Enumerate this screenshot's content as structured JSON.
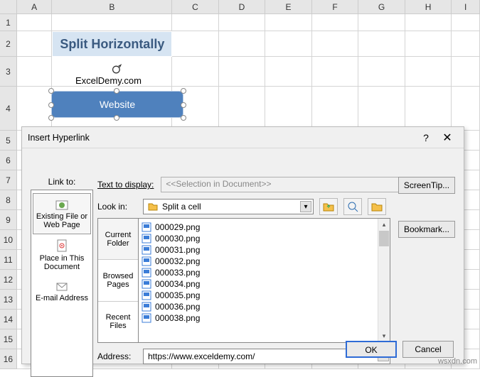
{
  "columns": [
    "A",
    "B",
    "C",
    "D",
    "E",
    "F",
    "G",
    "H",
    "I"
  ],
  "rows": [
    "1",
    "2",
    "3",
    "4",
    "5",
    "6",
    "7",
    "8",
    "9",
    "10",
    "11",
    "12",
    "13",
    "14",
    "15",
    "16"
  ],
  "cell_b2": "Split Horizontally",
  "shape_label": "Website",
  "shape_link_text": "ExcelDemy.com",
  "dialog": {
    "title": "Insert Hyperlink",
    "link_to_label": "Link to:",
    "text_to_display_label": "Text to display:",
    "text_to_display_value": "<<Selection in Document>>",
    "screentip_label": "ScreenTip...",
    "bookmark_label": "Bookmark...",
    "look_in_label": "Look in:",
    "look_in_value": "Split a cell",
    "linkto_items": [
      {
        "label": "Existing File or Web Page"
      },
      {
        "label": "Place in This Document"
      },
      {
        "label": "E-mail Address"
      }
    ],
    "tabs": [
      {
        "l1": "Current",
        "l2": "Folder"
      },
      {
        "l1": "Browsed",
        "l2": "Pages"
      },
      {
        "l1": "Recent",
        "l2": "Files"
      }
    ],
    "files": [
      "000029.png",
      "000030.png",
      "000031.png",
      "000032.png",
      "000033.png",
      "000034.png",
      "000035.png",
      "000036.png",
      "000038.png"
    ],
    "address_label": "Address:",
    "address_value": "https://www.exceldemy.com/",
    "ok": "OK",
    "cancel": "Cancel"
  },
  "watermark": "wsxdn.com"
}
